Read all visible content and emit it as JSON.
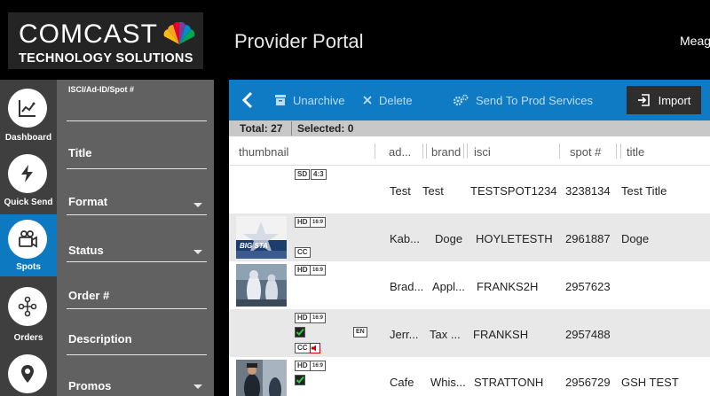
{
  "header": {
    "logo_main": "COMCAST",
    "logo_sub": "TECHNOLOGY SOLUTIONS",
    "portal_title": "Provider Portal",
    "user_name": "Meag"
  },
  "nav": {
    "items": [
      {
        "label": "Dashboard",
        "icon": "chart-icon",
        "active": false
      },
      {
        "label": "Quick Send",
        "icon": "lightning-icon",
        "active": false
      },
      {
        "label": "Spots",
        "icon": "camera-icon",
        "active": true
      },
      {
        "label": "Orders",
        "icon": "orders-icon",
        "active": false
      },
      {
        "label": "",
        "icon": "location-pin-icon",
        "active": false
      }
    ]
  },
  "filters": {
    "isci": "ISCI/Ad-ID/Spot #",
    "title": "Title",
    "format": "Format",
    "status": "Status",
    "order": "Order #",
    "description": "Description",
    "promos": "Promos"
  },
  "toolbar": {
    "unarchive": "Unarchive",
    "delete": "Delete",
    "send": "Send To Prod Services",
    "import": "Import"
  },
  "status": {
    "total": "Total: 27",
    "selected": "Selected: 0"
  },
  "table": {
    "columns": [
      "thumbnail",
      "ad...",
      "brand",
      "isci",
      "spot #",
      "title"
    ],
    "rows": [
      {
        "badges": [
          "SD",
          "4:3"
        ],
        "lang": "",
        "advertiser": "Test",
        "brand": "Test",
        "isci": "TESTSPOT1234",
        "spot": "3238134",
        "title": "Test Title"
      },
      {
        "badges": [
          "HD",
          "16:9",
          "CC"
        ],
        "lang": "",
        "advertiser": "Kab...",
        "brand": "Doge",
        "isci": "HOYLETESTH",
        "spot": "2961887",
        "title": "Doge"
      },
      {
        "badges": [
          "HD",
          "16:9"
        ],
        "lang": "",
        "advertiser": "Brad...",
        "brand": "Appl...",
        "isci": "FRANKS2H",
        "spot": "2957623",
        "title": ""
      },
      {
        "badges": [
          "HD",
          "16:9",
          "CC"
        ],
        "lang": "EN",
        "advertiser": "Jerr...",
        "brand": "Tax ...",
        "isci": "FRANKSH",
        "spot": "2957488",
        "title": ""
      },
      {
        "badges": [
          "HD",
          "16:9"
        ],
        "lang": "",
        "advertiser": "Cafe",
        "brand": "Whis...",
        "isci": "STRATTONH",
        "spot": "2956729",
        "title": "GSH TEST"
      }
    ]
  },
  "thumb_text": {
    "row2_logo": "BIG STA"
  },
  "colors": {
    "toolbar_blue": "#0e7bc4",
    "active_nav": "#0d79c1",
    "filter_panel": "#616161",
    "nav_bg": "#3f3f3f"
  }
}
